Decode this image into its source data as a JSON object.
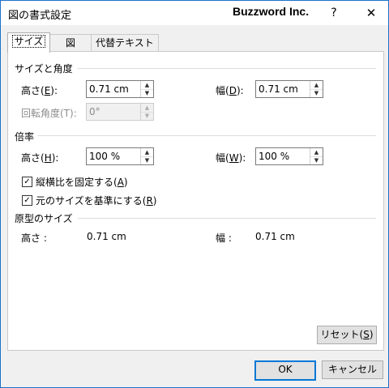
{
  "window": {
    "title": "図の書式設定",
    "brand": "Buzzword Inc.",
    "help": "?",
    "close": "✕"
  },
  "tabs": [
    {
      "label": "サイズ"
    },
    {
      "label": "図"
    },
    {
      "label": "代替テキスト"
    }
  ],
  "size_angle": {
    "heading": "サイズと角度",
    "height_label": "高さ(",
    "height_key": "E",
    "height_close": "):",
    "height_value": "0.71 cm",
    "width_label": "幅(",
    "width_key": "D",
    "width_close": "):",
    "width_value": "0.71 cm",
    "rotation_label": "回転角度(T):",
    "rotation_value": "0°"
  },
  "scale": {
    "heading": "倍率",
    "height_label": "高さ(",
    "height_key": "H",
    "height_close": "):",
    "height_value": "100 %",
    "width_label": "幅(",
    "width_key": "W",
    "width_close": "):",
    "width_value": "100 %",
    "lock_aspect_label": "縦横比を固定する(",
    "lock_aspect_key": "A",
    "lock_aspect_close": ")",
    "relative_label": "元のサイズを基準にする(",
    "relative_key": "R",
    "relative_close": ")",
    "check_mark": "✓"
  },
  "original": {
    "heading": "原型のサイズ",
    "height_label": "高さ :",
    "height_value": "0.71 cm",
    "width_label": "幅 :",
    "width_value": "0.71 cm"
  },
  "reset": {
    "label": "リセット(",
    "key": "S",
    "close": ")"
  },
  "footer": {
    "ok": "OK",
    "cancel": "キャンセル"
  },
  "icons": {
    "up": "▲",
    "down": "▼"
  },
  "colors": {
    "accent": "#0078d7",
    "window_border": "#1a73c9"
  }
}
